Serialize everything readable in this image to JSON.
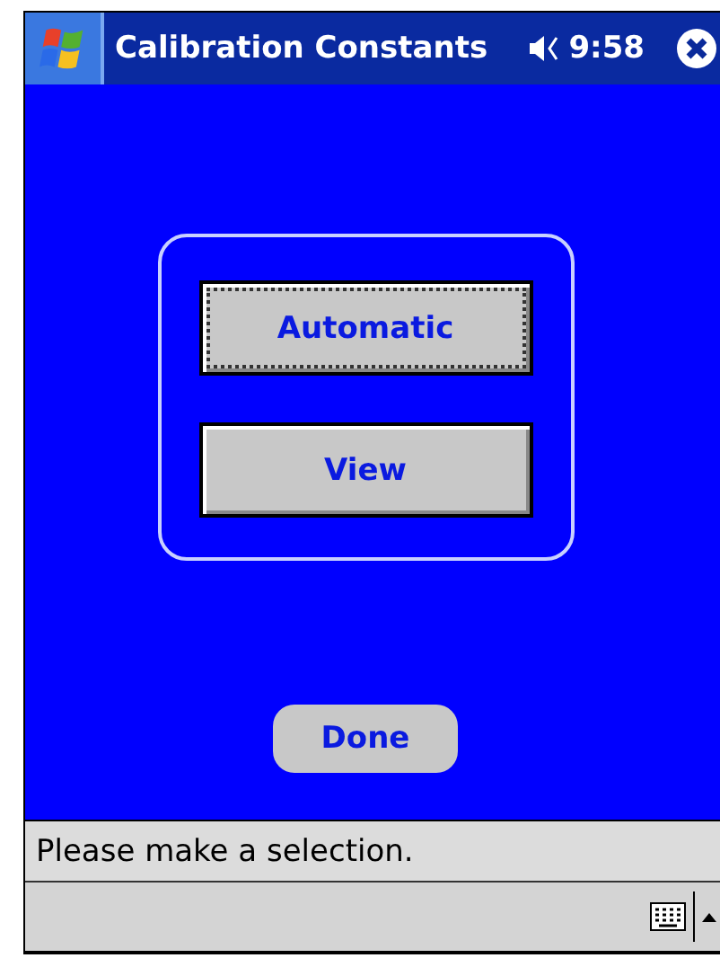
{
  "title_bar": {
    "title": "Calibration Constants",
    "time": "9:58"
  },
  "buttons": [
    {
      "label": "Automatic",
      "focused": true
    },
    {
      "label": "View",
      "focused": false
    }
  ],
  "done_button": {
    "label": "Done"
  },
  "status_bar": {
    "message": "Please make a selection."
  }
}
